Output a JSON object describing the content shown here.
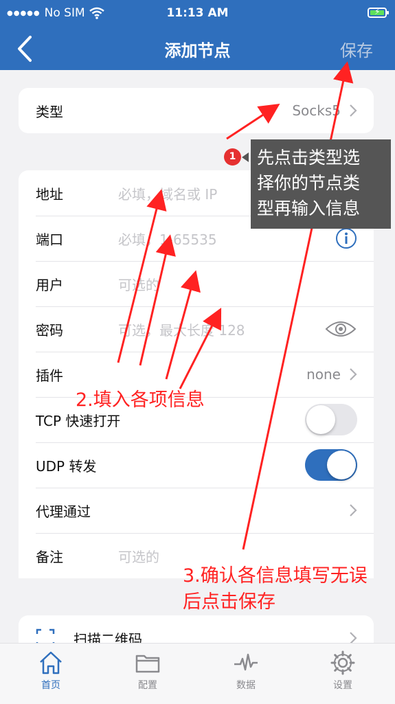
{
  "status_bar": {
    "carrier": "No SIM",
    "time": "11:13 AM"
  },
  "nav": {
    "title": "添加节点",
    "save_label": "保存"
  },
  "type_row": {
    "label": "类型",
    "value": "Socks5"
  },
  "form": {
    "address": {
      "label": "地址",
      "placeholder": "必填，域名或 IP"
    },
    "port": {
      "label": "端口",
      "placeholder": "必填，1-65535"
    },
    "user": {
      "label": "用户",
      "placeholder": "可选的"
    },
    "password": {
      "label": "密码",
      "placeholder": "可选，最大长度 128"
    },
    "plugin": {
      "label": "插件",
      "value": "none"
    },
    "tcp_fast_open": {
      "label": "TCP 快速打开",
      "on": false
    },
    "udp_relay": {
      "label": "UDP 转发",
      "on": true
    },
    "proxy_via": {
      "label": "代理通过"
    },
    "remark": {
      "label": "备注",
      "placeholder": "可选的"
    }
  },
  "scan_row": {
    "label": "扫描二维码"
  },
  "annotations": {
    "step1_badge": "1",
    "step1_text": [
      "先点击类型选",
      "择你的节点类",
      "型再输入信息"
    ],
    "step2_text": "2.填入各项信息",
    "step3_text": [
      "3.确认各信息填写无误",
      "后点击保存"
    ]
  },
  "tabs": [
    {
      "label": "首页",
      "icon": "home-icon",
      "active": true
    },
    {
      "label": "配置",
      "icon": "folder-icon",
      "active": false
    },
    {
      "label": "数据",
      "icon": "pulse-icon",
      "active": false
    },
    {
      "label": "设置",
      "icon": "gear-icon",
      "active": false
    }
  ],
  "colors": {
    "accent": "#2f6fbd",
    "annotation": "#ff2222",
    "tooltip_bg": "#555555"
  }
}
